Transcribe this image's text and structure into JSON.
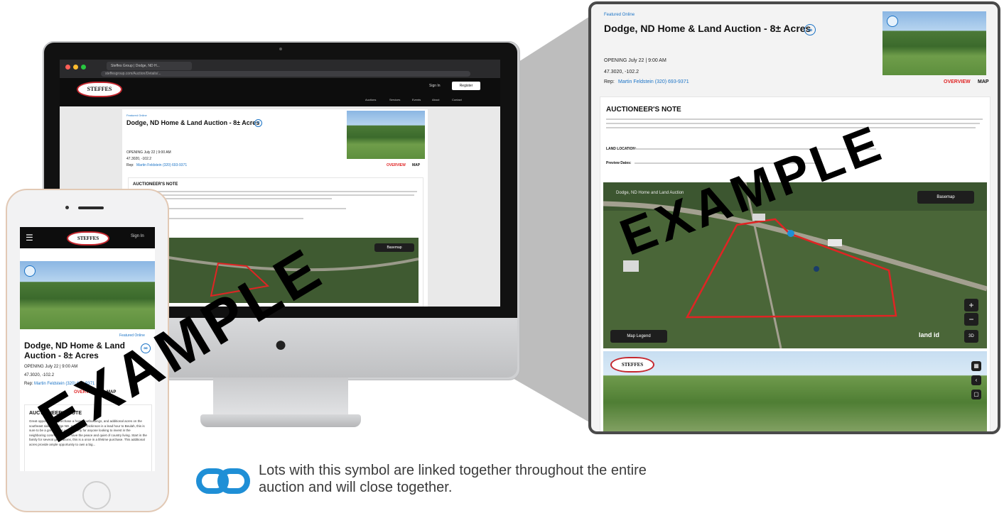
{
  "browser": {
    "tab_title": "Steffes Group | Dodge, ND H...",
    "url": "steffesgroup.com/Auction/Details/..."
  },
  "site": {
    "logo_text": "STEFFES",
    "sign_in": "Sign In",
    "register": "Register",
    "nav_items": [
      "Auctions",
      "Services",
      "Events",
      "About",
      "Contact"
    ]
  },
  "listing": {
    "featured_label": "Featured Online",
    "title": "Dodge, ND Home & Land Auction - 8± Acres",
    "opening": "OPENING July 22 | 9:00 AM",
    "location": "47.3020, -102.2",
    "rep_label": "Rep:",
    "rep_value": "Martin Feldstein (320) 693-9371",
    "overview_tab": "OVERVIEW",
    "map_tab": "MAP"
  },
  "note": {
    "heading": "AUCTIONEER'S NOTE",
    "body_phone": "Great opportunity to purchase a home, outbuildings, and additional acres on the southeast side of Dodge ND. An hour to Dickinson is a lead hour to Beulah, this is sure to be a great home and property for anyone looking to invest in the neighboring communities yet have the peace and quiet of country living. Start in the family for several generations, this is a once in a lifetime purchase. This additional acres provide ample opportunity to own a big...",
    "land_location_label": "LAND LOCATION:",
    "preview_label": "Preview Dates:"
  },
  "map": {
    "basemap_label": "Basemap",
    "legend_label": "Map Legend",
    "provider": "land id",
    "zoom_in": "+",
    "zoom_out": "−",
    "three_d": "3D",
    "caption": "Dodge, ND Home and Land Auction"
  },
  "watermark": "EXAMPLE",
  "phone": {
    "menu_icon": "hamburger-icon",
    "sign_in": "Sign In",
    "title": "Dodge, ND Home & Land Auction - 8± Acres",
    "opening": "OPENING July 22 | 9:00 AM",
    "location": "47.3020, -102.2",
    "rep_label": "Rep:",
    "rep_value": "Martin Feldstein (320) 693-9371",
    "overview_tab": "OVERVIEW",
    "map_tab": "MAP"
  },
  "legend": {
    "icon": "link-icon",
    "text": "Lots with this symbol are linked together throughout the entire auction and will close together."
  },
  "colors": {
    "accent_blue": "#1a73c6",
    "overview_red": "#e02424",
    "link_icon_blue": "#1f8fd6",
    "frame_dark": "#4a4a4a"
  }
}
